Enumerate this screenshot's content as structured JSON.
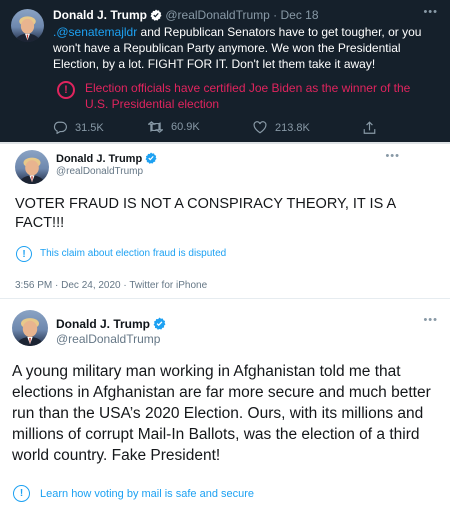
{
  "tweets": [
    {
      "name": "Donald J. Trump",
      "handle": "@realDonaldTrump",
      "separator": "·",
      "date": "Dec 18",
      "mention": ".@senatemajldr",
      "text": " and Republican Senators have to get tougher, or you won't have a Republican Party anymore. We won the Presidential Election, by a lot. FIGHT FOR IT. Don't let them take it away!",
      "notice": "Election officials have certified Joe Biden as the winner of the U.S. Presidential election",
      "notice_icon": "exclamation-icon",
      "replies": "31.5K",
      "retweets": "60.9K",
      "likes": "213.8K",
      "colors": {
        "background": "#15202b",
        "notice": "#e0245e",
        "muted": "#8899a6"
      }
    },
    {
      "name": "Donald J. Trump",
      "handle": "@realDonaldTrump",
      "text": "VOTER FRAUD IS NOT A CONSPIRACY THEORY, IT IS A FACT!!!",
      "notice": "This claim about election fraud is disputed",
      "notice_icon": "exclamation-icon",
      "time": "3:56 PM · Dec 24, 2020 · Twitter for iPhone",
      "colors": {
        "link": "#1da1f2"
      }
    },
    {
      "name": "Donald J. Trump",
      "handle": "@realDonaldTrump",
      "text": "A young military man working in Afghanistan told me that elections in Afghanistan are far more secure and much better run than the USA’s 2020 Election. Ours, with its millions and millions of corrupt Mail-In Ballots, was the election of a third world country. Fake President!",
      "notice": "Learn how voting by mail is safe and secure",
      "notice_icon": "exclamation-icon",
      "colors": {
        "link": "#1da1f2"
      }
    }
  ],
  "icons": {
    "more": "more-icon",
    "verified": "verified-badge-icon",
    "reply": "reply-icon",
    "retweet": "retweet-icon",
    "like": "heart-icon",
    "share": "share-icon"
  }
}
